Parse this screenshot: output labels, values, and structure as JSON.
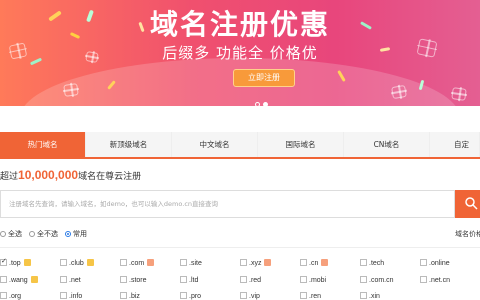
{
  "banner": {
    "title": "域名注册优惠",
    "subtitle": "后缀多  功能全  价格优",
    "button_label": "立即注册",
    "dots": 2,
    "active_dot": 0
  },
  "tabs": [
    {
      "label": "热门域名",
      "active": true
    },
    {
      "label": "新顶级域名",
      "active": false
    },
    {
      "label": "中文域名",
      "active": false
    },
    {
      "label": "国际域名",
      "active": false
    },
    {
      "label": "CN域名",
      "active": false
    },
    {
      "label": "自定",
      "active": false
    }
  ],
  "headline": {
    "prefix": "超过",
    "count": "10,000,000",
    "suffix": "域名在尊云注册"
  },
  "search": {
    "placeholder": "注册域名先查询，请输入域名，如demo，也可以输入demo.cn直接查询"
  },
  "filters": {
    "options": [
      {
        "label": "全选",
        "selected": false
      },
      {
        "label": "全不选",
        "selected": false
      },
      {
        "label": "常用",
        "selected": true
      }
    ],
    "price_link": "域名价格"
  },
  "tlds": [
    [
      {
        "name": ".top",
        "checked": true,
        "badge": "hot"
      },
      {
        "name": ".club",
        "checked": false,
        "badge": "hot"
      },
      {
        "name": ".com",
        "checked": false,
        "badge": "new"
      },
      {
        "name": ".site",
        "checked": false,
        "badge": ""
      },
      {
        "name": ".xyz",
        "checked": false,
        "badge": "new"
      },
      {
        "name": ".cn",
        "checked": false,
        "badge": "new"
      },
      {
        "name": ".tech",
        "checked": false,
        "badge": ""
      },
      {
        "name": ".online",
        "checked": false,
        "badge": ""
      }
    ],
    [
      {
        "name": ".wang",
        "checked": false,
        "badge": "hot"
      },
      {
        "name": ".net",
        "checked": false,
        "badge": ""
      },
      {
        "name": ".store",
        "checked": false,
        "badge": ""
      },
      {
        "name": ".ltd",
        "checked": false,
        "badge": ""
      },
      {
        "name": ".red",
        "checked": false,
        "badge": ""
      },
      {
        "name": ".mobi",
        "checked": false,
        "badge": ""
      },
      {
        "name": ".com.cn",
        "checked": false,
        "badge": ""
      },
      {
        "name": ".net.cn",
        "checked": false,
        "badge": ""
      }
    ],
    [
      {
        "name": ".org",
        "checked": false,
        "badge": ""
      },
      {
        "name": ".info",
        "checked": false,
        "badge": ""
      },
      {
        "name": ".biz",
        "checked": false,
        "badge": ""
      },
      {
        "name": ".pro",
        "checked": false,
        "badge": ""
      },
      {
        "name": ".vip",
        "checked": false,
        "badge": ""
      },
      {
        "name": ".ren",
        "checked": false,
        "badge": ""
      },
      {
        "name": ".xin",
        "checked": false,
        "badge": ""
      }
    ]
  ],
  "colors": {
    "accent": "#f06436",
    "banner_start": "#ff7a59",
    "banner_end": "#e45f92",
    "button": "#f89a3a"
  },
  "icons": {
    "search_button": "search-icon",
    "banner_decoration": "gift-icon"
  }
}
